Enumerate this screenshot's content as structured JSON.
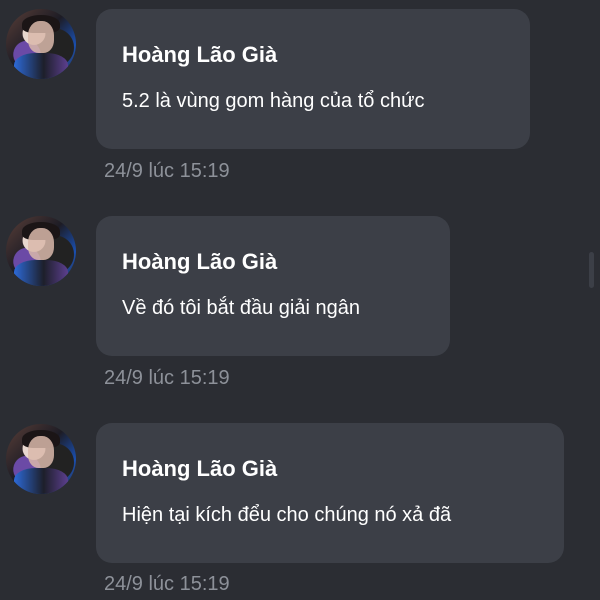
{
  "messages": [
    {
      "sender": "Hoàng Lão Già",
      "text": "5.2 là vùng gom hàng của tổ chức",
      "timestamp": "24/9 lúc 15:19"
    },
    {
      "sender": "Hoàng Lão Già",
      "text": "Về đó tôi bắt đầu giải ngân",
      "timestamp": "24/9 lúc 15:19"
    },
    {
      "sender": "Hoàng Lão Già",
      "text": "Hiện tại kích đểu cho chúng nó xả đã",
      "timestamp": "24/9 lúc 15:19"
    }
  ],
  "colors": {
    "background": "#2b2d33",
    "bubble": "#3c3f47",
    "text": "#ffffff",
    "timestamp": "#8d9199"
  }
}
